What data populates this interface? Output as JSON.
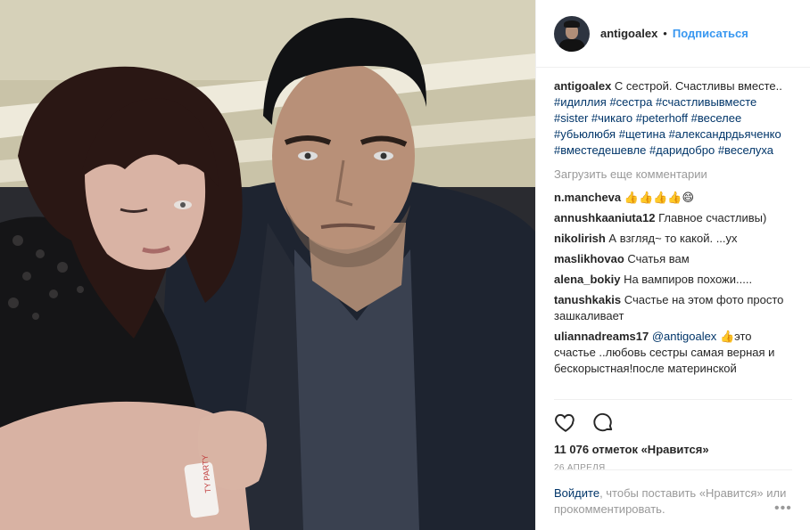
{
  "post": {
    "username": "antigoalex",
    "dot": "•",
    "follow_label": "Подписаться",
    "caption_text": "С сестрой. Счастливы вместе..",
    "hashtags": [
      "#идиллия",
      "#сестра",
      "#счастливывместе",
      "#sister",
      "#чикаго",
      "#peterhoff",
      "#веселее",
      "#убьюлюбя",
      "#щетина",
      "#александрдьяченко",
      "#вместедешевле",
      "#даридобро",
      "#веселуха"
    ],
    "load_more_label": "Загрузить еще комментарии",
    "comments": [
      {
        "user": "n.mancheva",
        "text": "👍👍👍👍😄"
      },
      {
        "user": "annushkaaniuta12",
        "text": "Главное счастливы)"
      },
      {
        "user": "nikolirish",
        "text": "А взгляд~ то какой. ...ух"
      },
      {
        "user": "maslikhovao",
        "text": "Счатья вам"
      },
      {
        "user": "alena_bokiy",
        "text": "На вампиров похожи....."
      },
      {
        "user": "tanushkakis",
        "text": "Счастье на этом фото просто зашкаливает"
      },
      {
        "user": "uliannadreams17",
        "mention": "@antigoalex",
        "text": "👍это счастье ..любовь сестры самая верная и бескорыстная!после материнской"
      }
    ],
    "likes_label": "11 076 отметок «Нравится»",
    "date_label": "26 АПРЕЛЯ",
    "login_link": "Войдите",
    "login_text": ", чтобы поставить «Нравится» или прокомментировать.",
    "more_label": "•••",
    "colors": {
      "link": "#3897f0",
      "tag": "#003569",
      "muted": "#999999",
      "border": "#efefef"
    },
    "icons": [
      "heart-icon",
      "comment-icon",
      "more-options-icon"
    ]
  }
}
